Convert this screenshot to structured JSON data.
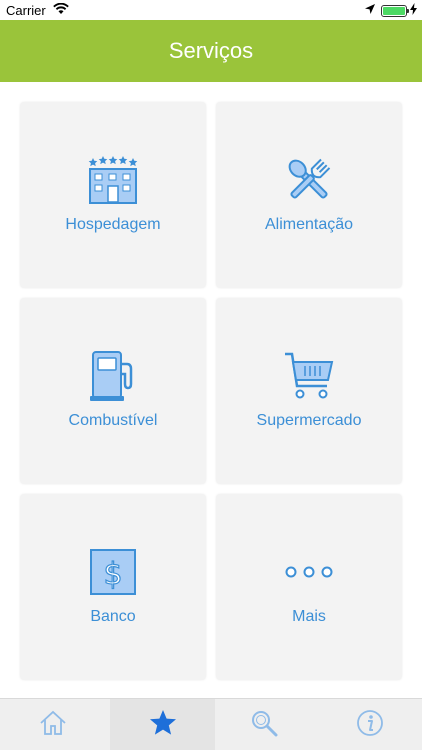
{
  "status_bar": {
    "carrier": "Carrier",
    "time": ""
  },
  "nav": {
    "title": "Serviços"
  },
  "tiles": [
    {
      "label": "Hospedagem",
      "icon": "hotel-icon"
    },
    {
      "label": "Alimentação",
      "icon": "fork-spoon-icon"
    },
    {
      "label": "Combustível",
      "icon": "fuel-pump-icon"
    },
    {
      "label": "Supermercado",
      "icon": "shopping-cart-icon"
    },
    {
      "label": "Banco",
      "icon": "dollar-icon"
    },
    {
      "label": "Mais",
      "icon": "more-dots-icon"
    }
  ],
  "tab_bar": {
    "items": [
      {
        "icon": "home-icon",
        "active": false
      },
      {
        "icon": "star-icon",
        "active": true
      },
      {
        "icon": "search-icon",
        "active": false
      },
      {
        "icon": "info-icon",
        "active": false
      }
    ]
  },
  "colors": {
    "nav_background": "#9ac43a",
    "accent_blue": "#3c8fd6",
    "icon_fill": "#a9cdf5",
    "tile_background": "#f3f3f3"
  }
}
